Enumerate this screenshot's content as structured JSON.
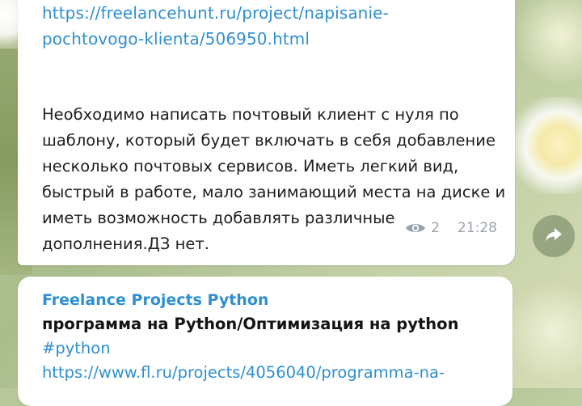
{
  "message_1": {
    "link_line_1": "https://freelancehunt.ru/project/napisanie-",
    "link_line_2": "pochtovogo-klienta/506950.html",
    "text": "Необходимо написать почтовый клиент с нуля по шаблону, который будет включать в себя добавление несколько почтовых сервисов. Иметь легкий вид, быстрый в работе, мало занимающий места на диске и иметь возможность добавлять различные дополнения.ДЗ нет.",
    "views": "2",
    "time": "21:28"
  },
  "message_2": {
    "channel": "Freelance Projects Python",
    "title": "программа на Python/Оптимизация на python",
    "hashtag": "#python",
    "link": "https://www.fl.ru/projects/4056040/programma-na-"
  },
  "icons": {
    "views": "eye-icon",
    "share": "share-arrow-icon"
  },
  "colors": {
    "link": "#2f8fcf",
    "meta": "#9aa3ab",
    "bubble": "#ffffff"
  }
}
